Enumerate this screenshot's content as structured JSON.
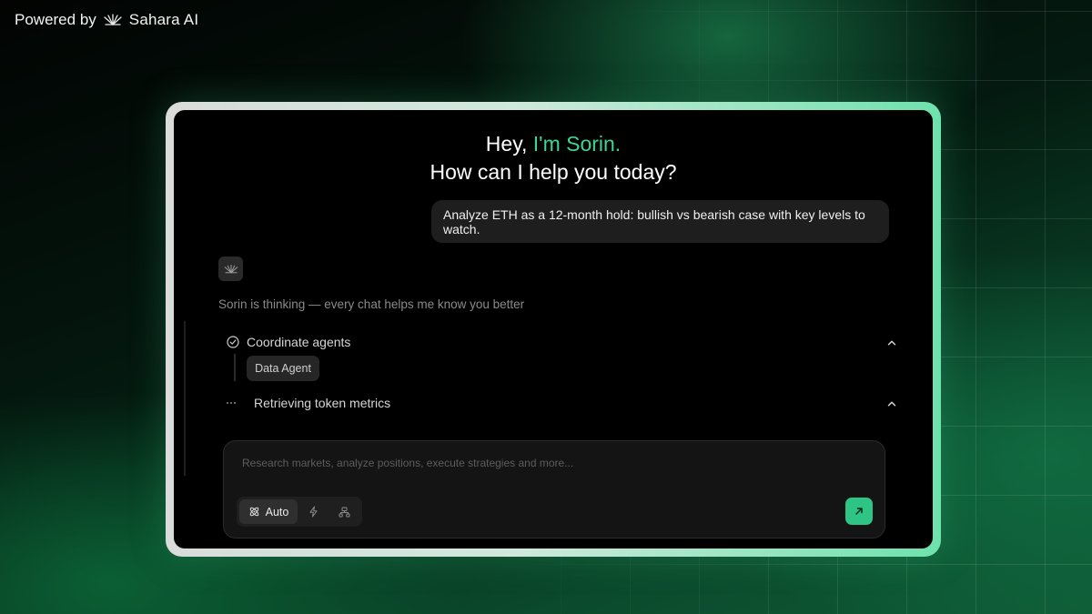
{
  "header": {
    "powered_by": "Powered by",
    "brand": "Sahara AI",
    "brand_icon": "sahara-logo-icon"
  },
  "greeting": {
    "prefix": "Hey,",
    "name": "I'm Sorin.",
    "question": "How can I help you today?",
    "accent_color": "#3fd492"
  },
  "user_message": "Analyze ETH as a 12-month hold: bullish vs bearish case with key levels to watch.",
  "assistant": {
    "avatar_icon": "sahara-logo-icon",
    "status": "Sorin is thinking — every chat helps me know you better",
    "steps": [
      {
        "label": "Coordinate agents",
        "icon": "check-circle-icon",
        "chips": [
          "Data Agent"
        ]
      },
      {
        "label": "Retrieving token metrics",
        "icon": "loading-dots-icon"
      }
    ]
  },
  "composer": {
    "placeholder": "Research markets, analyze positions, execute strategies and more...",
    "modes": [
      {
        "label": "Auto",
        "icon": "atom-icon",
        "selected": true
      },
      {
        "label": "",
        "icon": "lightning-icon"
      },
      {
        "label": "",
        "icon": "agents-icon"
      }
    ],
    "send_icon": "arrow-up-right-icon",
    "send_color": "#2dc486"
  }
}
